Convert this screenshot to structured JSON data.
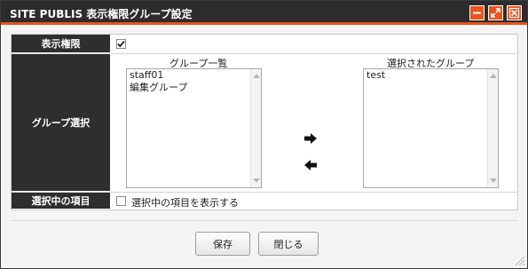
{
  "window": {
    "title": "SITE PUBLIS 表示権限グループ設定",
    "accent_color": "#e8531e",
    "titlebar_color": "#2c2c2c",
    "buttons": [
      "minimize-icon",
      "maximize-icon",
      "close-icon"
    ]
  },
  "form": {
    "display_permission": {
      "label": "表示権限",
      "checked": true
    },
    "group_selection": {
      "label": "グループ選択",
      "available_title": "グループ一覧",
      "available_items": [
        "staff01",
        "編集グループ"
      ],
      "selected_title": "選択されたグループ",
      "selected_items": [
        "test"
      ],
      "move_right_icon": "arrow-right-icon",
      "move_left_icon": "arrow-left-icon"
    },
    "selected_items_row": {
      "label": "選択中の項目",
      "checkbox_label": "選択中の項目を表示する",
      "checked": false
    }
  },
  "footer": {
    "save_label": "保存",
    "close_label": "閉じる"
  }
}
